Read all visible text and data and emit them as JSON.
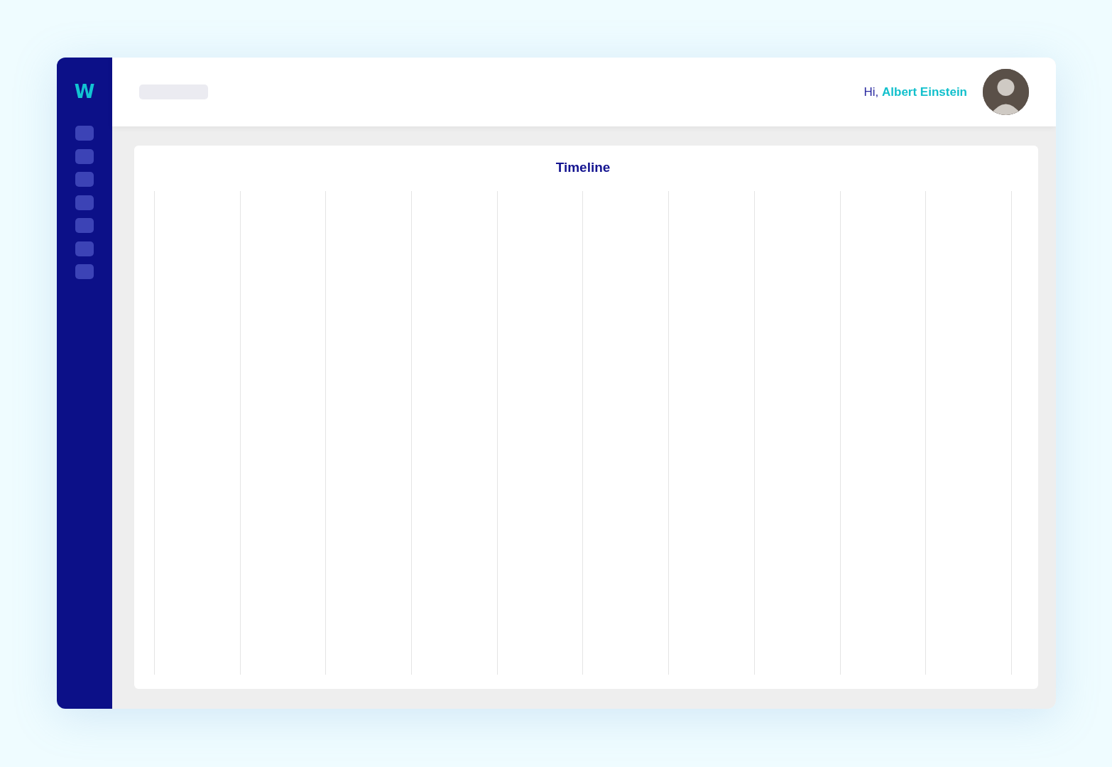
{
  "sidebar": {
    "logo": "W"
  },
  "header": {
    "greeting": "Hi, **Albert Einstein**"
  },
  "timeline": {
    "title": "Timeline"
  }
}
